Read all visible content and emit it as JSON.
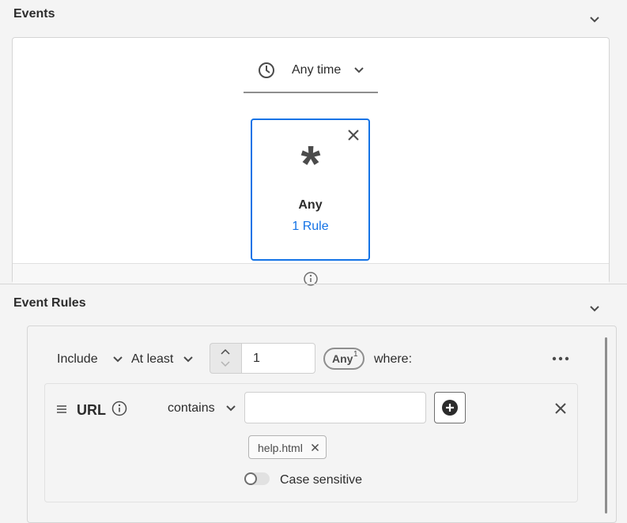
{
  "events": {
    "title": "Events",
    "time_filter": "Any time",
    "card": {
      "symbol": "*",
      "name": "Any",
      "rule_count": "1 Rule"
    }
  },
  "event_rules": {
    "title": "Event Rules",
    "include_label": "Include",
    "quantifier_label": "At least",
    "count_value": "1",
    "any_pill": "Any",
    "any_superscript": "1",
    "where_label": "where:",
    "rule": {
      "field": "URL",
      "operator": "contains",
      "input_value": "",
      "tag": "help.html",
      "case_label": "Case sensitive"
    }
  },
  "icons": [
    "chevron-down-icon",
    "clock-icon",
    "close-icon",
    "info-icon",
    "more-icon",
    "drag-handle-icon",
    "add-circle-icon",
    "stepper-up-icon",
    "stepper-down-icon"
  ]
}
